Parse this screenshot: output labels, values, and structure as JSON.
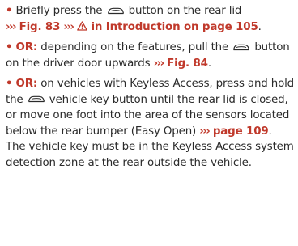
{
  "colors": {
    "accent": "#c0392b",
    "text": "#2a2a2a"
  },
  "bullet_char": "•",
  "xref_prefix": "›››",
  "icons": {
    "rear_lid_button": "car-rear-lid-icon",
    "warning": "warning-triangle-icon"
  },
  "p1": {
    "t1": "Briefly press the",
    "t2": "button on the rear lid",
    "fig_ref": "Fig. 83",
    "intro_ref": "in Introduction on page 105",
    "end": "."
  },
  "p2": {
    "or_label": "OR:",
    "t1": "depending on the features, pull the",
    "t2": "button on the driver door upwards",
    "fig_ref": "Fig. 84",
    "end": "."
  },
  "p3": {
    "or_label": "OR:",
    "t1": "on vehicles with Keyless Access, press and hold the",
    "t2": "vehicle key button until the rear lid is closed, or move one foot into the area of the sensors located below the rear bumper (Easy Open)",
    "page_ref": "page 109",
    "t3": ". The vehi­cle key must be in the Keyless Access system detection zone at the rear outside the vehi­cle."
  }
}
